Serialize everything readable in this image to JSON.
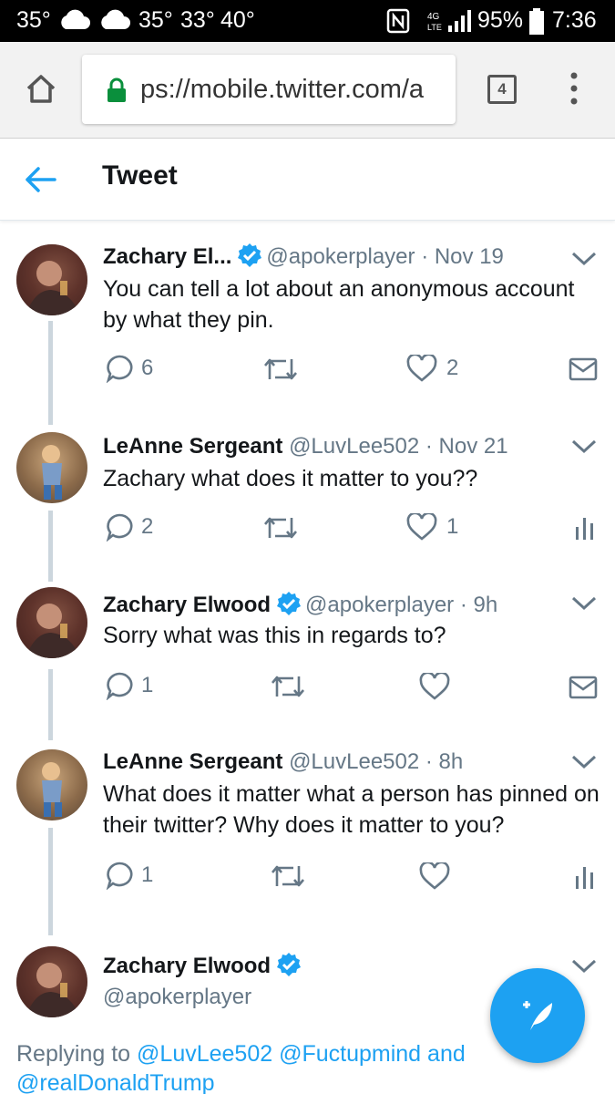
{
  "status_bar": {
    "temp1": "35°",
    "temp2": "35°",
    "temp3": "33°",
    "temp4": "40°",
    "battery": "95%",
    "time": "7:36",
    "icons": [
      "cloud-icon",
      "cloud-icon",
      "nfc-icon",
      "lte-icon",
      "signal-icon",
      "battery-icon"
    ]
  },
  "browser": {
    "url": "ps://mobile.twitter.com/a",
    "tab_count": "4",
    "icons": [
      "home-icon",
      "lock-icon",
      "more-icon"
    ],
    "colors": {
      "lock": "#0a8f3c"
    }
  },
  "header": {
    "title": "Tweet"
  },
  "tweets": [
    {
      "name": "Zachary El...",
      "verified": true,
      "handle": "@apokerplayer · Nov 19",
      "text": "You can tell a lot about an anonymous account by what they pin.",
      "replies": "6",
      "retweets": "",
      "likes": "2",
      "last_action": "mail-icon"
    },
    {
      "name": "LeAnne Sergeant",
      "verified": false,
      "handle": "@LuvLee502 · Nov 21",
      "text": "Zachary what does it matter to you??",
      "replies": "2",
      "retweets": "",
      "likes": "1",
      "last_action": "analytics-icon"
    },
    {
      "name": "Zachary Elwood",
      "verified": true,
      "handle": "@apokerplayer · 9h",
      "text": "Sorry what was this in regards to?",
      "replies": "1",
      "retweets": "",
      "likes": "",
      "last_action": "mail-icon"
    },
    {
      "name": "LeAnne Sergeant",
      "verified": false,
      "handle": "@LuvLee502 · 8h",
      "text": "What does it matter what a person has pinned on their twitter? Why does it matter to you?",
      "replies": "1",
      "retweets": "",
      "likes": "",
      "last_action": "analytics-icon"
    }
  ],
  "main_tweet": {
    "name": "Zachary Elwood",
    "handle": "@apokerplayer",
    "replying_prefix": "Replying to",
    "mention1": "@LuvLee502",
    "mention2": "@Fuctupmind",
    "conj": "and",
    "mention3": "@realDonaldTrump"
  },
  "colors": {
    "accent": "#1da1f2",
    "text": "#14171a",
    "muted": "#657786",
    "thread_line": "#ccd6dd"
  }
}
